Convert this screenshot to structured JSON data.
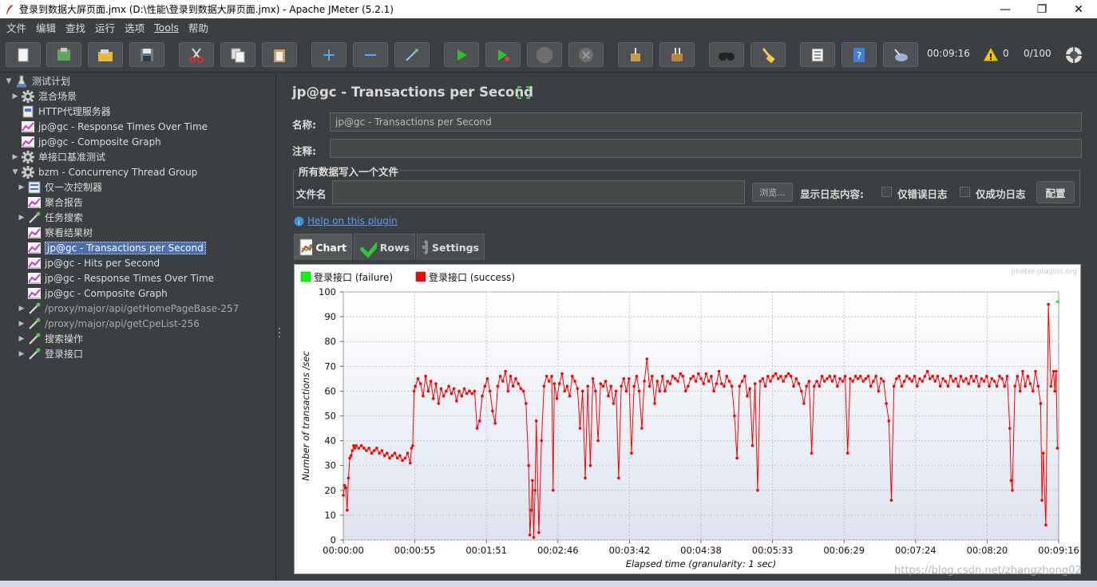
{
  "window": {
    "title": "登录到数据大屏页面.jmx (D:\\性能\\登录到数据大屏页面.jmx) - Apache JMeter (5.2.1)",
    "minimize": "—",
    "maximize": "❐",
    "close": "✕"
  },
  "menu": [
    "文件",
    "编辑",
    "查找",
    "运行",
    "选项",
    "Tools",
    "帮助"
  ],
  "toolbar": {
    "elapsed": "00:09:16",
    "warnings": "0",
    "threads": "0/100"
  },
  "tree": {
    "items": [
      {
        "label": "测试计划",
        "expanded": true
      },
      {
        "label": "混合场景"
      },
      {
        "label": "HTTP代理服务器"
      },
      {
        "label": "jp@gc - Response Times Over Time"
      },
      {
        "label": "jp@gc - Composite Graph"
      },
      {
        "label": "单接口基准测试"
      },
      {
        "label": "bzm - Concurrency Thread Group"
      },
      {
        "label": "仅一次控制器"
      },
      {
        "label": "聚合报告"
      },
      {
        "label": "任务搜索"
      },
      {
        "label": "察看结果树"
      },
      {
        "label": "jp@gc - Transactions per Second"
      },
      {
        "label": "jp@gc - Hits per Second"
      },
      {
        "label": "jp@gc - Response Times Over Time"
      },
      {
        "label": "jp@gc - Composite Graph"
      },
      {
        "label": "/proxy/major/api/getHomePageBase-257"
      },
      {
        "label": "/proxy/major/api/getCpeList-256"
      },
      {
        "label": "搜索操作"
      },
      {
        "label": "登录接口"
      }
    ]
  },
  "panel": {
    "title": "jp@gc - Transactions per Second",
    "name_label": "名称:",
    "name_value": "jp@gc - Transactions per Second",
    "comment_label": "注释:",
    "comment_value": "",
    "file_group_title": "所有数据写入一个文件",
    "filename_label": "文件名",
    "filename_value": "",
    "browse_label": "浏览...",
    "log_label": "显示日志内容:",
    "errors_only": "仅错误日志",
    "success_only": "仅成功日志",
    "config_label": "配置",
    "help_link": "Help on this plugin",
    "tabs": [
      "Chart",
      "Rows",
      "Settings"
    ]
  },
  "chart_data": {
    "type": "line",
    "watermark": "jmeter-plugins.org",
    "xlabel": "Elapsed time (granularity: 1 sec)",
    "ylabel": "Number of transactions /sec",
    "ylim": [
      0,
      100
    ],
    "yticks": [
      0,
      10,
      20,
      30,
      40,
      50,
      60,
      70,
      80,
      90,
      100
    ],
    "xlim_sec": [
      0,
      556
    ],
    "xticks": [
      "00:00:00",
      "00:00:55",
      "00:01:51",
      "00:02:46",
      "00:03:42",
      "00:04:38",
      "00:05:33",
      "00:06:29",
      "00:07:24",
      "00:08:20",
      "00:09:16"
    ],
    "grid": true,
    "legend_position": "top-left",
    "series": [
      {
        "name": "登录接口 (failure)",
        "color": "#00ff00",
        "points": [
          [
            555,
            96
          ]
        ]
      },
      {
        "name": "登录接口 (success)",
        "color": "#ff0000",
        "points": [
          [
            0,
            18
          ],
          [
            1,
            22
          ],
          [
            2,
            21
          ],
          [
            3,
            12
          ],
          [
            4,
            25
          ],
          [
            5,
            33
          ],
          [
            6,
            34
          ],
          [
            7,
            36
          ],
          [
            8,
            38
          ],
          [
            9,
            37
          ],
          [
            10,
            38
          ],
          [
            12,
            37
          ],
          [
            14,
            38
          ],
          [
            16,
            37
          ],
          [
            18,
            36
          ],
          [
            20,
            37
          ],
          [
            22,
            35
          ],
          [
            24,
            36
          ],
          [
            26,
            37
          ],
          [
            28,
            35
          ],
          [
            30,
            36
          ],
          [
            32,
            34
          ],
          [
            34,
            35
          ],
          [
            36,
            33
          ],
          [
            38,
            34
          ],
          [
            40,
            35
          ],
          [
            42,
            33
          ],
          [
            44,
            34
          ],
          [
            46,
            32
          ],
          [
            48,
            33
          ],
          [
            50,
            35
          ],
          [
            52,
            31
          ],
          [
            53,
            37
          ],
          [
            54,
            38
          ],
          [
            55,
            60
          ],
          [
            56,
            62
          ],
          [
            58,
            65
          ],
          [
            60,
            63
          ],
          [
            62,
            58
          ],
          [
            64,
            66
          ],
          [
            66,
            60
          ],
          [
            68,
            64
          ],
          [
            70,
            57
          ],
          [
            72,
            63
          ],
          [
            74,
            55
          ],
          [
            76,
            61
          ],
          [
            78,
            58
          ],
          [
            80,
            60
          ],
          [
            82,
            62
          ],
          [
            84,
            59
          ],
          [
            86,
            61
          ],
          [
            88,
            56
          ],
          [
            90,
            60
          ],
          [
            92,
            58
          ],
          [
            94,
            61
          ],
          [
            96,
            59
          ],
          [
            98,
            60
          ],
          [
            100,
            59
          ],
          [
            102,
            60
          ],
          [
            104,
            45
          ],
          [
            106,
            48
          ],
          [
            108,
            58
          ],
          [
            110,
            62
          ],
          [
            112,
            65
          ],
          [
            114,
            60
          ],
          [
            116,
            52
          ],
          [
            118,
            47
          ],
          [
            120,
            62
          ],
          [
            122,
            66
          ],
          [
            124,
            64
          ],
          [
            126,
            68
          ],
          [
            128,
            60
          ],
          [
            130,
            66
          ],
          [
            132,
            62
          ],
          [
            134,
            65
          ],
          [
            136,
            63
          ],
          [
            138,
            61
          ],
          [
            140,
            60
          ],
          [
            142,
            55
          ],
          [
            144,
            30
          ],
          [
            145,
            2
          ],
          [
            146,
            12
          ],
          [
            147,
            24
          ],
          [
            148,
            1
          ],
          [
            149,
            20
          ],
          [
            150,
            48
          ],
          [
            152,
            3
          ],
          [
            154,
            40
          ],
          [
            156,
            62
          ],
          [
            158,
            66
          ],
          [
            160,
            64
          ],
          [
            162,
            66
          ],
          [
            163,
            20
          ],
          [
            164,
            63
          ],
          [
            166,
            57
          ],
          [
            168,
            63
          ],
          [
            170,
            67
          ],
          [
            172,
            60
          ],
          [
            174,
            62
          ],
          [
            176,
            58
          ],
          [
            178,
            66
          ],
          [
            180,
            64
          ],
          [
            182,
            61
          ],
          [
            184,
            45
          ],
          [
            186,
            60
          ],
          [
            188,
            25
          ],
          [
            190,
            62
          ],
          [
            192,
            30
          ],
          [
            194,
            65
          ],
          [
            196,
            60
          ],
          [
            198,
            40
          ],
          [
            200,
            63
          ],
          [
            202,
            62
          ],
          [
            204,
            64
          ],
          [
            206,
            58
          ],
          [
            208,
            62
          ],
          [
            210,
            55
          ],
          [
            212,
            60
          ],
          [
            214,
            25
          ],
          [
            216,
            62
          ],
          [
            218,
            65
          ],
          [
            220,
            60
          ],
          [
            222,
            65
          ],
          [
            224,
            35
          ],
          [
            226,
            62
          ],
          [
            228,
            66
          ],
          [
            230,
            60
          ],
          [
            232,
            45
          ],
          [
            234,
            64
          ],
          [
            236,
            73
          ],
          [
            238,
            62
          ],
          [
            240,
            66
          ],
          [
            242,
            55
          ],
          [
            244,
            64
          ],
          [
            246,
            60
          ],
          [
            248,
            66
          ],
          [
            250,
            60
          ],
          [
            252,
            64
          ],
          [
            254,
            63
          ],
          [
            256,
            66
          ],
          [
            258,
            65
          ],
          [
            260,
            64
          ],
          [
            262,
            67
          ],
          [
            264,
            66
          ],
          [
            266,
            60
          ],
          [
            268,
            62
          ],
          [
            270,
            65
          ],
          [
            272,
            66
          ],
          [
            274,
            64
          ],
          [
            276,
            67
          ],
          [
            278,
            65
          ],
          [
            280,
            63
          ],
          [
            282,
            67
          ],
          [
            284,
            64
          ],
          [
            286,
            66
          ],
          [
            288,
            60
          ],
          [
            290,
            63
          ],
          [
            292,
            68
          ],
          [
            294,
            63
          ],
          [
            296,
            62
          ],
          [
            298,
            66
          ],
          [
            300,
            64
          ],
          [
            302,
            62
          ],
          [
            304,
            50
          ],
          [
            306,
            33
          ],
          [
            308,
            62
          ],
          [
            310,
            64
          ],
          [
            312,
            66
          ],
          [
            314,
            58
          ],
          [
            316,
            61
          ],
          [
            318,
            38
          ],
          [
            320,
            63
          ],
          [
            322,
            20
          ],
          [
            324,
            64
          ],
          [
            326,
            65
          ],
          [
            328,
            62
          ],
          [
            330,
            66
          ],
          [
            332,
            64
          ],
          [
            334,
            66
          ],
          [
            336,
            67
          ],
          [
            338,
            65
          ],
          [
            340,
            66
          ],
          [
            342,
            64
          ],
          [
            344,
            66
          ],
          [
            346,
            67
          ],
          [
            348,
            66
          ],
          [
            350,
            62
          ],
          [
            352,
            65
          ],
          [
            354,
            63
          ],
          [
            356,
            60
          ],
          [
            358,
            55
          ],
          [
            360,
            62
          ],
          [
            362,
            64
          ],
          [
            364,
            35
          ],
          [
            366,
            62
          ],
          [
            368,
            64
          ],
          [
            370,
            62
          ],
          [
            372,
            66
          ],
          [
            374,
            64
          ],
          [
            376,
            65
          ],
          [
            378,
            66
          ],
          [
            380,
            64
          ],
          [
            382,
            66
          ],
          [
            384,
            62
          ],
          [
            386,
            65
          ],
          [
            388,
            64
          ],
          [
            390,
            66
          ],
          [
            392,
            35
          ],
          [
            394,
            65
          ],
          [
            396,
            64
          ],
          [
            398,
            66
          ],
          [
            400,
            65
          ],
          [
            402,
            66
          ],
          [
            404,
            64
          ],
          [
            406,
            65
          ],
          [
            408,
            66
          ],
          [
            410,
            62
          ],
          [
            412,
            64
          ],
          [
            414,
            66
          ],
          [
            416,
            60
          ],
          [
            418,
            65
          ],
          [
            420,
            64
          ],
          [
            422,
            55
          ],
          [
            424,
            48
          ],
          [
            426,
            16
          ],
          [
            428,
            62
          ],
          [
            430,
            65
          ],
          [
            432,
            66
          ],
          [
            434,
            62
          ],
          [
            436,
            64
          ],
          [
            438,
            66
          ],
          [
            440,
            65
          ],
          [
            442,
            64
          ],
          [
            444,
            66
          ],
          [
            446,
            62
          ],
          [
            448,
            65
          ],
          [
            450,
            64
          ],
          [
            452,
            66
          ],
          [
            454,
            68
          ],
          [
            456,
            65
          ],
          [
            458,
            66
          ],
          [
            460,
            64
          ],
          [
            462,
            66
          ],
          [
            464,
            62
          ],
          [
            466,
            65
          ],
          [
            468,
            64
          ],
          [
            470,
            62
          ],
          [
            472,
            66
          ],
          [
            474,
            64
          ],
          [
            476,
            65
          ],
          [
            478,
            62
          ],
          [
            480,
            66
          ],
          [
            482,
            64
          ],
          [
            484,
            65
          ],
          [
            486,
            63
          ],
          [
            488,
            66
          ],
          [
            490,
            64
          ],
          [
            492,
            66
          ],
          [
            494,
            62
          ],
          [
            496,
            65
          ],
          [
            498,
            64
          ],
          [
            500,
            66
          ],
          [
            502,
            62
          ],
          [
            504,
            65
          ],
          [
            506,
            64
          ],
          [
            508,
            62
          ],
          [
            510,
            66
          ],
          [
            512,
            65
          ],
          [
            514,
            62
          ],
          [
            516,
            66
          ],
          [
            518,
            45
          ],
          [
            519,
            24
          ],
          [
            520,
            20
          ],
          [
            522,
            62
          ],
          [
            524,
            66
          ],
          [
            526,
            60
          ],
          [
            528,
            68
          ],
          [
            530,
            62
          ],
          [
            532,
            66
          ],
          [
            534,
            63
          ],
          [
            536,
            60
          ],
          [
            538,
            68
          ],
          [
            540,
            62
          ],
          [
            542,
            55
          ],
          [
            543,
            16
          ],
          [
            544,
            35
          ],
          [
            546,
            6
          ],
          [
            548,
            95
          ],
          [
            550,
            62
          ],
          [
            552,
            68
          ],
          [
            553,
            60
          ],
          [
            554,
            68
          ],
          [
            555,
            37
          ]
        ]
      }
    ]
  }
}
